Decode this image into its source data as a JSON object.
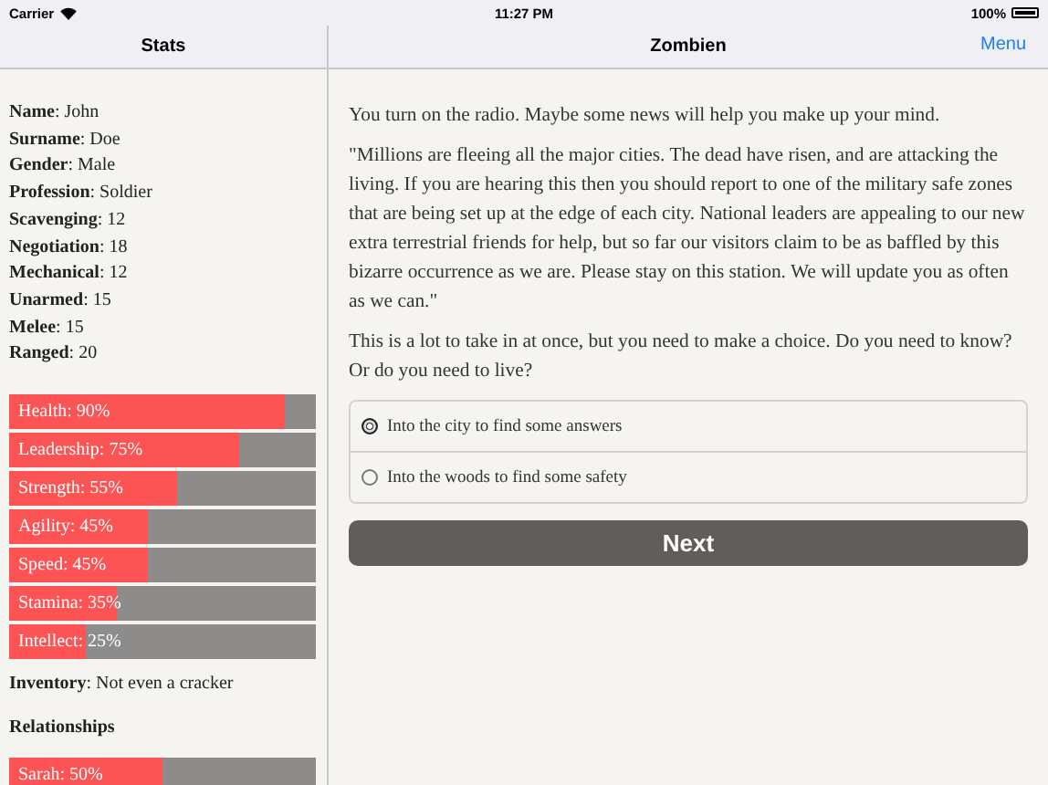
{
  "status_bar": {
    "carrier": "Carrier",
    "time": "11:27 PM",
    "battery": "100%"
  },
  "sidebar": {
    "title": "Stats",
    "attributes": [
      "**Name**: John",
      "**Surname**: Doe",
      "**Gender**: Male",
      "**Profession**: Soldier",
      "**Scavenging**: 12",
      "**Negotiation**: 18",
      "**Mechanical**: 12",
      "**Unarmed**: 15",
      "**Melee**: 15",
      "**Ranged**: 20"
    ],
    "meters": [
      {
        "label": "Health: 90%",
        "level": 0.9
      },
      {
        "label": "Leadership: 75%",
        "level": 0.75
      },
      {
        "label": "Strength: 55%",
        "level": 0.55
      },
      {
        "label": "Agility: 45%",
        "level": 0.45
      },
      {
        "label": "Speed: 45%",
        "level": 0.45
      },
      {
        "label": "Stamina: 35%",
        "level": 0.35
      },
      {
        "label": "Intellect: 25%",
        "level": 0.25
      }
    ],
    "inventory": "**Inventory**: Not even a cracker",
    "relationships_heading": "Relationships",
    "relationships": [
      {
        "label": "Sarah: 50%",
        "level": 0.5
      }
    ]
  },
  "main": {
    "title": "Zombien",
    "menu_button": "Menu",
    "paragraphs": [
      "You turn on the radio. Maybe some news will help you make up your mind.",
      "\"Millions are fleeing all the major cities. The dead have risen, and are attacking the living. If you are hearing this then you should report to one of the military safe zones that are being set up at the edge of each city. National leaders are appealing to our new extra terrestrial friends for help, but so far our visitors claim to be as baffled by this bizarre occurrence as we are. Please stay on this station. We will update you as often as we can.\"",
      "This is a lot to take in at once, but you need to make a choice. Do you need to know? Or do you need to live?"
    ],
    "choices": [
      {
        "label": "Into the city to find some answers",
        "selected": true
      },
      {
        "label": "Into the woods to find some safety",
        "selected": false
      }
    ],
    "next_button": "Next"
  }
}
